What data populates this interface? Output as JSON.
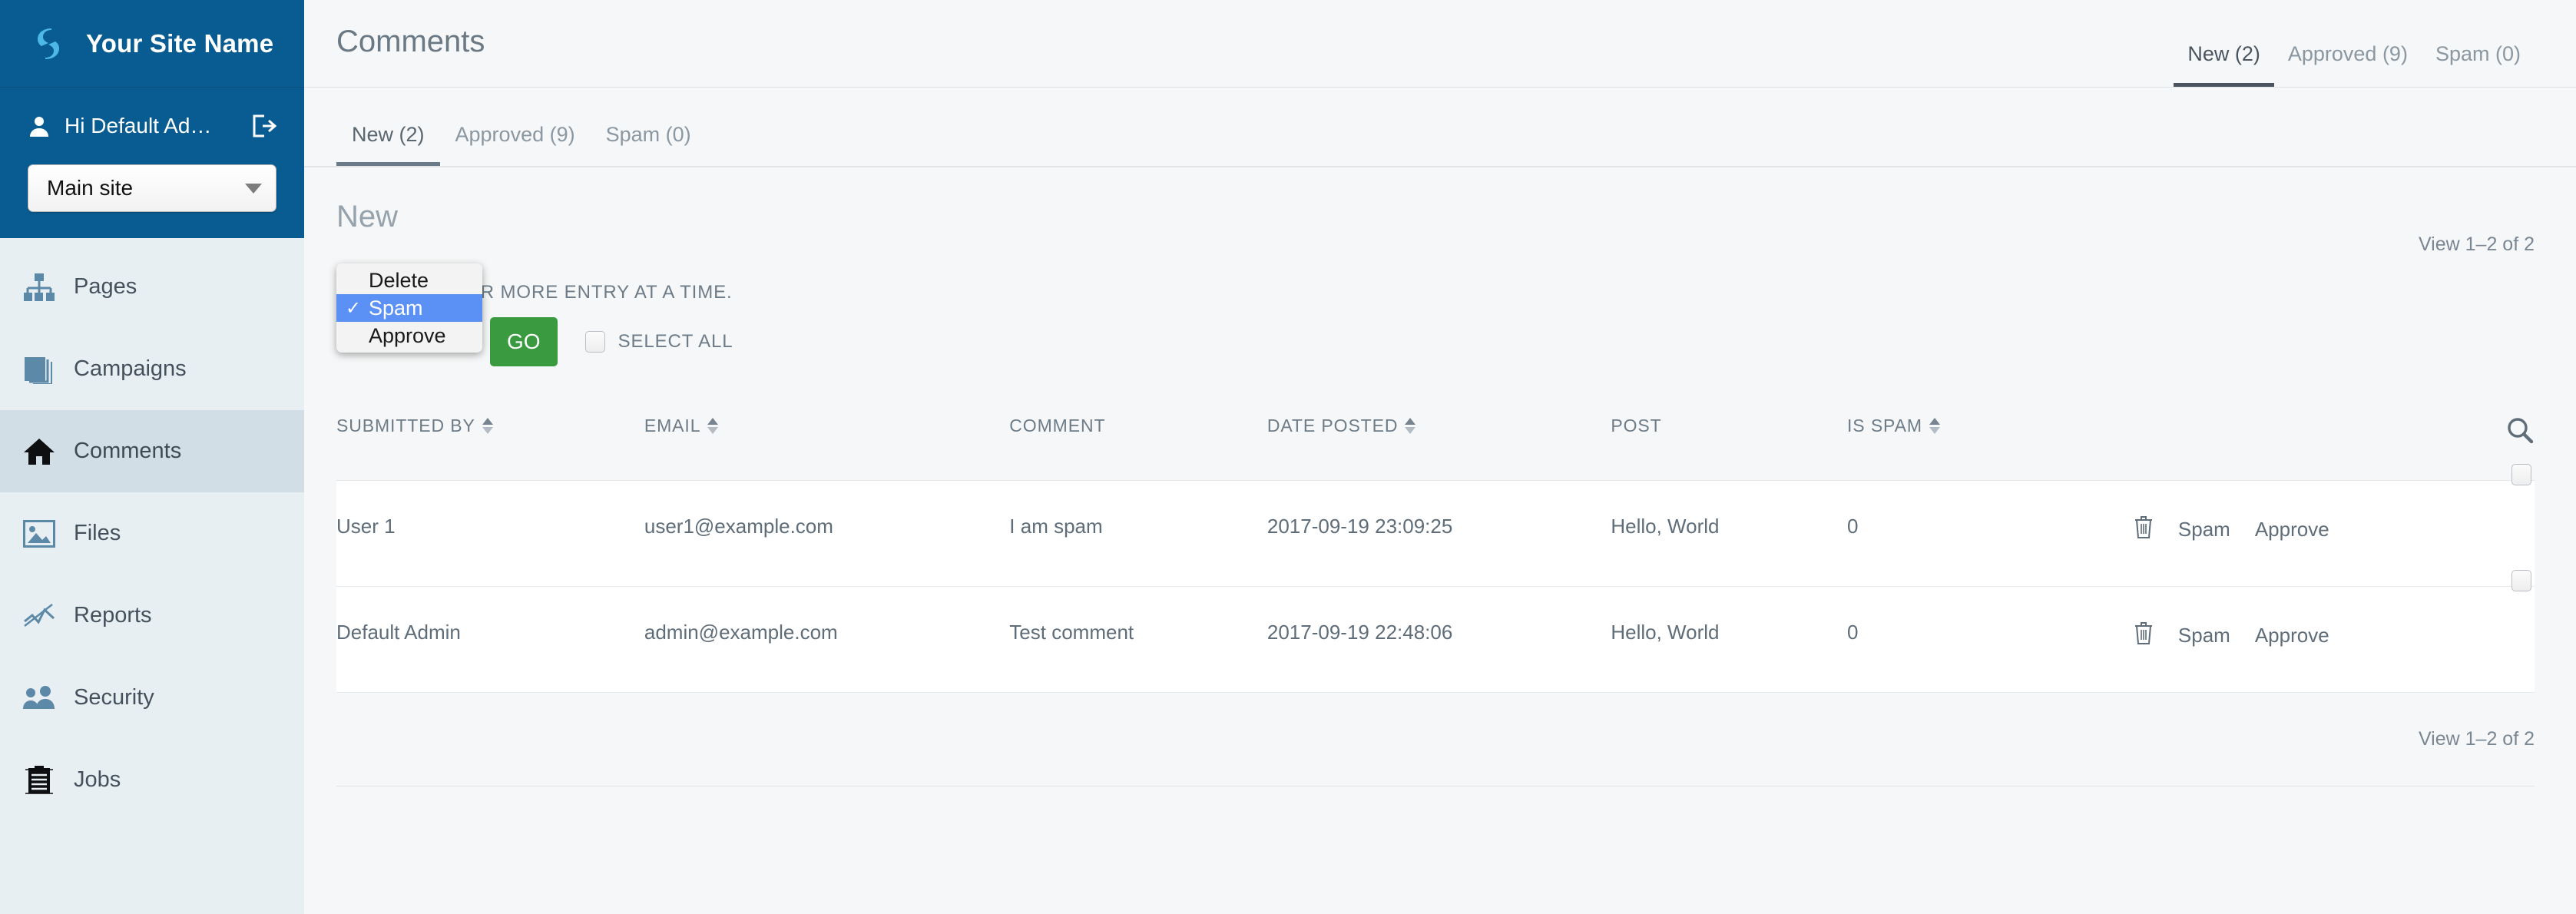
{
  "sidebar": {
    "brand": {
      "name": "Your Site Name",
      "logo_icon": "link-logo-icon",
      "bg_color": "#085c92"
    },
    "user": {
      "greeting": "Hi Default Ad…",
      "user_icon": "user-icon",
      "logout_icon": "logout-icon"
    },
    "site_selector": {
      "value": "Main site",
      "caret_icon": "chevron-down-icon"
    },
    "items": [
      {
        "label": "Pages",
        "icon": "sitemap-icon",
        "active": false
      },
      {
        "label": "Campaigns",
        "icon": "layers-icon",
        "active": false
      },
      {
        "label": "Comments",
        "icon": "home-icon",
        "active": true
      },
      {
        "label": "Files",
        "icon": "image-icon",
        "active": false
      },
      {
        "label": "Reports",
        "icon": "chart-line-icon",
        "active": false
      },
      {
        "label": "Security",
        "icon": "users-icon",
        "active": false
      },
      {
        "label": "Jobs",
        "icon": "clipboard-icon",
        "active": false
      }
    ]
  },
  "header": {
    "title": "Comments",
    "tabs": [
      {
        "label": "New (2)",
        "active": true
      },
      {
        "label": "Approved (9)",
        "active": false
      },
      {
        "label": "Spam (0)",
        "active": false
      }
    ]
  },
  "subtabs": [
    {
      "label": "New (2)",
      "active": true
    },
    {
      "label": "Approved (9)",
      "active": false
    },
    {
      "label": "Spam (0)",
      "active": false
    }
  ],
  "section": {
    "title": "New",
    "view_count_top": "View 1–2 of 2",
    "view_count_bottom": "View 1–2 of 2"
  },
  "bulk": {
    "caption": "MODIFY ONE OR MORE ENTRY AT A TIME.",
    "go_label": "GO",
    "select_all_label": "SELECT ALL",
    "go_color": "#3a9a3f",
    "dropdown": {
      "open": true,
      "selected": "Spam",
      "highlight_color": "#5b91f5",
      "check_glyph": "✓",
      "options": [
        "Delete",
        "Spam",
        "Approve"
      ]
    }
  },
  "table": {
    "columns": [
      {
        "label": "SUBMITTED BY",
        "sortable": true
      },
      {
        "label": "EMAIL",
        "sortable": true
      },
      {
        "label": "COMMENT",
        "sortable": false
      },
      {
        "label": "DATE POSTED",
        "sortable": true
      },
      {
        "label": "POST",
        "sortable": false
      },
      {
        "label": "IS SPAM",
        "sortable": true
      },
      {
        "label": "",
        "sortable": false
      }
    ],
    "search_icon": "search-icon",
    "rows": [
      {
        "submitted_by": "User 1",
        "email": "user1@example.com",
        "comment": "I am spam",
        "date_posted": "2017-09-19 23:09:25",
        "post": "Hello, World",
        "is_spam": "0",
        "delete_icon": "trash-icon",
        "spam_label": "Spam",
        "approve_label": "Approve",
        "checked": false
      },
      {
        "submitted_by": "Default Admin",
        "email": "admin@example.com",
        "comment": "Test comment",
        "date_posted": "2017-09-19 22:48:06",
        "post": "Hello, World",
        "is_spam": "0",
        "delete_icon": "trash-icon",
        "spam_label": "Spam",
        "approve_label": "Approve",
        "checked": false
      }
    ]
  }
}
